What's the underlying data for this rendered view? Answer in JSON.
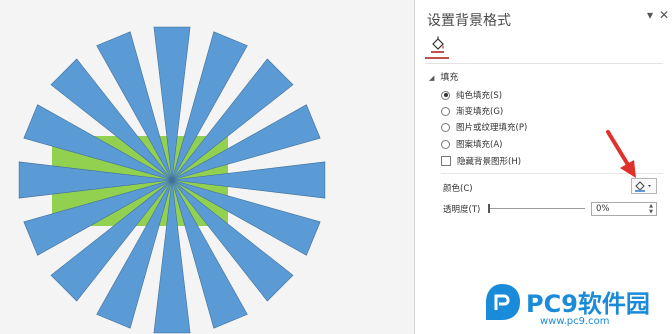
{
  "pane": {
    "title": "设置背景格式",
    "pin_label": "▾",
    "close_label": "✕",
    "section_title": "填充",
    "fill_options": [
      {
        "label": "纯色填充(S)",
        "selected": true
      },
      {
        "label": "渐变填充(G)",
        "selected": false
      },
      {
        "label": "图片或纹理填充(P)",
        "selected": false
      },
      {
        "label": "图案填充(A)",
        "selected": false
      }
    ],
    "hide_bg_label": "隐藏背景图形(H)",
    "color_label": "颜色(C)",
    "transparency_label": "透明度(T)",
    "transparency_value": "0%",
    "transparency_fraction": 0
  },
  "slide": {
    "ray_color": "#5b9bd5",
    "rect_color": "#92d050",
    "ray_count": 16
  },
  "icons": {
    "fill_tab": "paint-bucket-icon",
    "color_picker": "paint-bucket-icon",
    "arrow": "red-pointer-arrow"
  },
  "watermark": {
    "brand": "PC9软件园",
    "url": "www.pc9.com"
  }
}
